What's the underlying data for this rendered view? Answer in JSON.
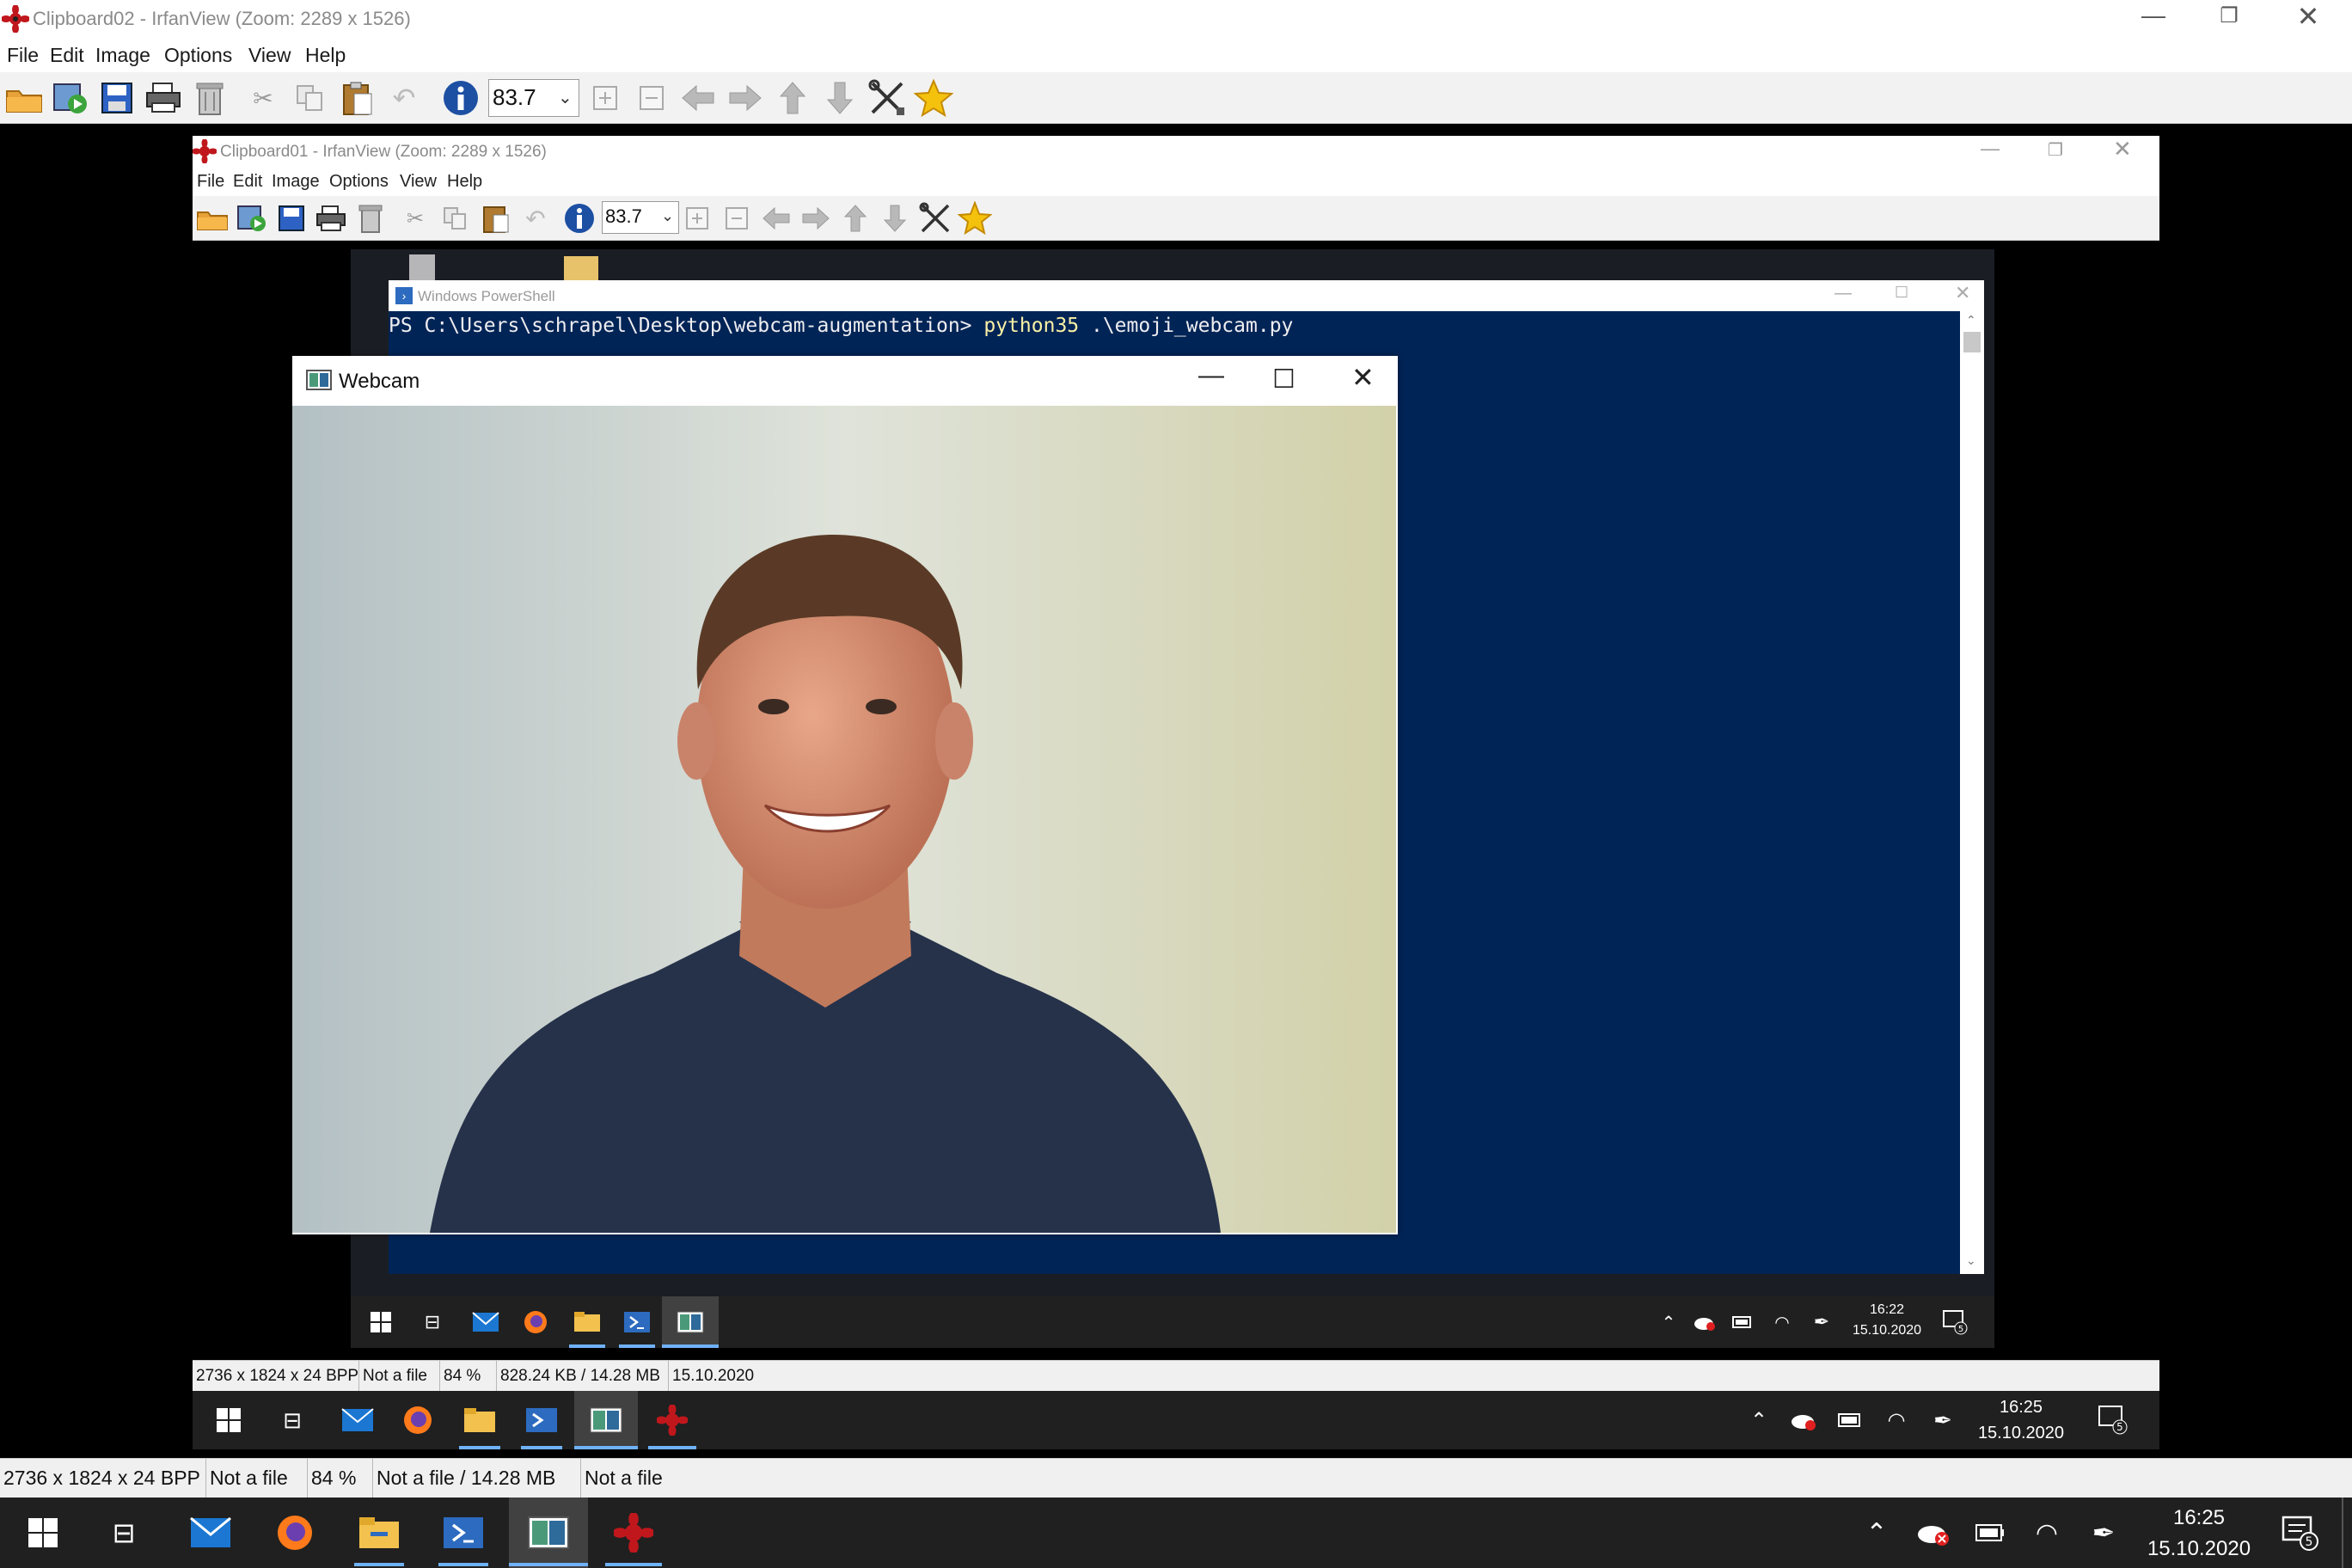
{
  "outer": {
    "title": "Clipboard02 - IrfanView (Zoom: 2289 x 1526)",
    "menu": [
      "File",
      "Edit",
      "Image",
      "Options",
      "View",
      "Help"
    ],
    "zoom_value": "83.7",
    "status": [
      "2736 x 1824 x 24 BPP",
      "Not a file",
      "84 %",
      "Not a file / 14.28 MB",
      "Not a file"
    ]
  },
  "inner": {
    "title": "Clipboard01 - IrfanView (Zoom: 2289 x 1526)",
    "menu": [
      "File",
      "Edit",
      "Image",
      "Options",
      "View",
      "Help"
    ],
    "zoom_value": "83.7",
    "status": [
      "2736 x 1824 x 24 BPP",
      "Not a file",
      "84 %",
      "828.24 KB / 14.28 MB",
      "15.10.2020"
    ]
  },
  "powershell": {
    "title": "Windows PowerShell",
    "prompt": "PS C:\\Users\\schrapel\\Desktop\\webcam-augmentation> ",
    "command": "python35",
    "args": " .\\emoji_webcam.py",
    "bg_color": "#012456"
  },
  "webcam": {
    "title": "Webcam"
  },
  "taskbar_outer": {
    "time": "16:25",
    "date": "15.10.2020",
    "notifications": "5"
  },
  "taskbar_mid": {
    "time": "16:25",
    "date": "15.10.2020",
    "notifications": "5"
  },
  "taskbar_inner": {
    "time": "16:22",
    "date": "15.10.2020",
    "notifications": "5"
  },
  "colors": {
    "taskbar": "#202020",
    "accent": "#6fb1f7",
    "ps_blue": "#012456"
  }
}
